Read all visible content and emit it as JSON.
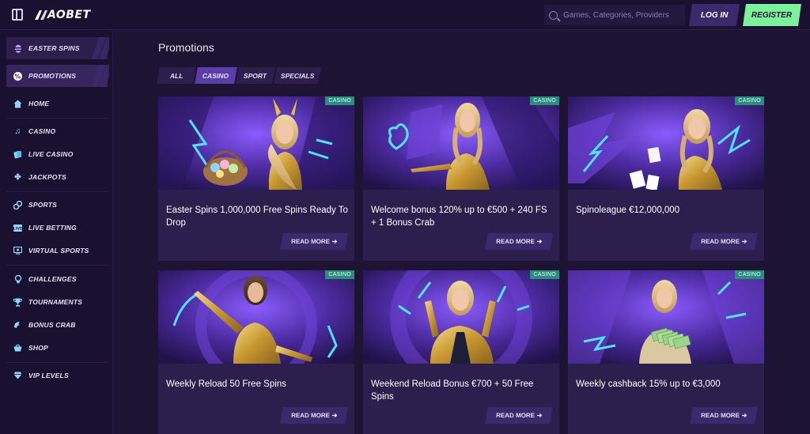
{
  "header": {
    "logo_text": "AOBET",
    "search_placeholder": "Games, Categories, Providers",
    "login_label": "LOG IN",
    "register_label": "REGISTER"
  },
  "sidebar": {
    "items": [
      {
        "label": "EASTER SPINS",
        "icon": "egg-icon"
      },
      {
        "label": "PROMOTIONS",
        "icon": "percent-icon"
      },
      {
        "label": "HOME",
        "icon": "home-icon"
      },
      {
        "label": "CASINO",
        "icon": "music-note-icon"
      },
      {
        "label": "LIVE CASINO",
        "icon": "cards-icon"
      },
      {
        "label": "JACKPOTS",
        "icon": "clover-icon"
      },
      {
        "label": "SPORTS",
        "icon": "sports-icon"
      },
      {
        "label": "LIVE BETTING",
        "icon": "live-icon"
      },
      {
        "label": "VIRTUAL SPORTS",
        "icon": "screen-icon"
      },
      {
        "label": "CHALLENGES",
        "icon": "medal-icon"
      },
      {
        "label": "TOURNAMENTS",
        "icon": "trophy-icon"
      },
      {
        "label": "BONUS CRAB",
        "icon": "crab-icon"
      },
      {
        "label": "SHOP",
        "icon": "basket-icon"
      },
      {
        "label": "VIP LEVELS",
        "icon": "diamond-icon"
      }
    ]
  },
  "main": {
    "title": "Promotions",
    "filters": [
      "ALL",
      "CASINO",
      "SPORT",
      "SPECIALS"
    ],
    "active_filter": "CASINO",
    "cards": [
      {
        "badge": "CASINO",
        "title": "Easter Spins 1,000,000 Free Spins Ready To Drop",
        "cta": "READ MORE"
      },
      {
        "badge": "CASINO",
        "title": "Welcome bonus 120% up to €500 + 240 FS + 1 Bonus Crab",
        "cta": "READ MORE"
      },
      {
        "badge": "CASINO",
        "title": "Spinoleague €12,000,000",
        "cta": "READ MORE"
      },
      {
        "badge": "CASINO",
        "title": "Weekly Reload 50 Free Spins",
        "cta": "READ MORE"
      },
      {
        "badge": "CASINO",
        "title": "Weekend Reload Bonus €700 + 50 Free Spins",
        "cta": "READ MORE"
      },
      {
        "badge": "CASINO",
        "title": "Weekly cashback 15% up to €3,000",
        "cta": "READ MORE"
      }
    ]
  },
  "colors": {
    "background": "#1d1333",
    "card": "#2c1f4e",
    "accent": "#5a3ea6",
    "register": "#7cf29c",
    "badge": "#2a8d7e"
  }
}
